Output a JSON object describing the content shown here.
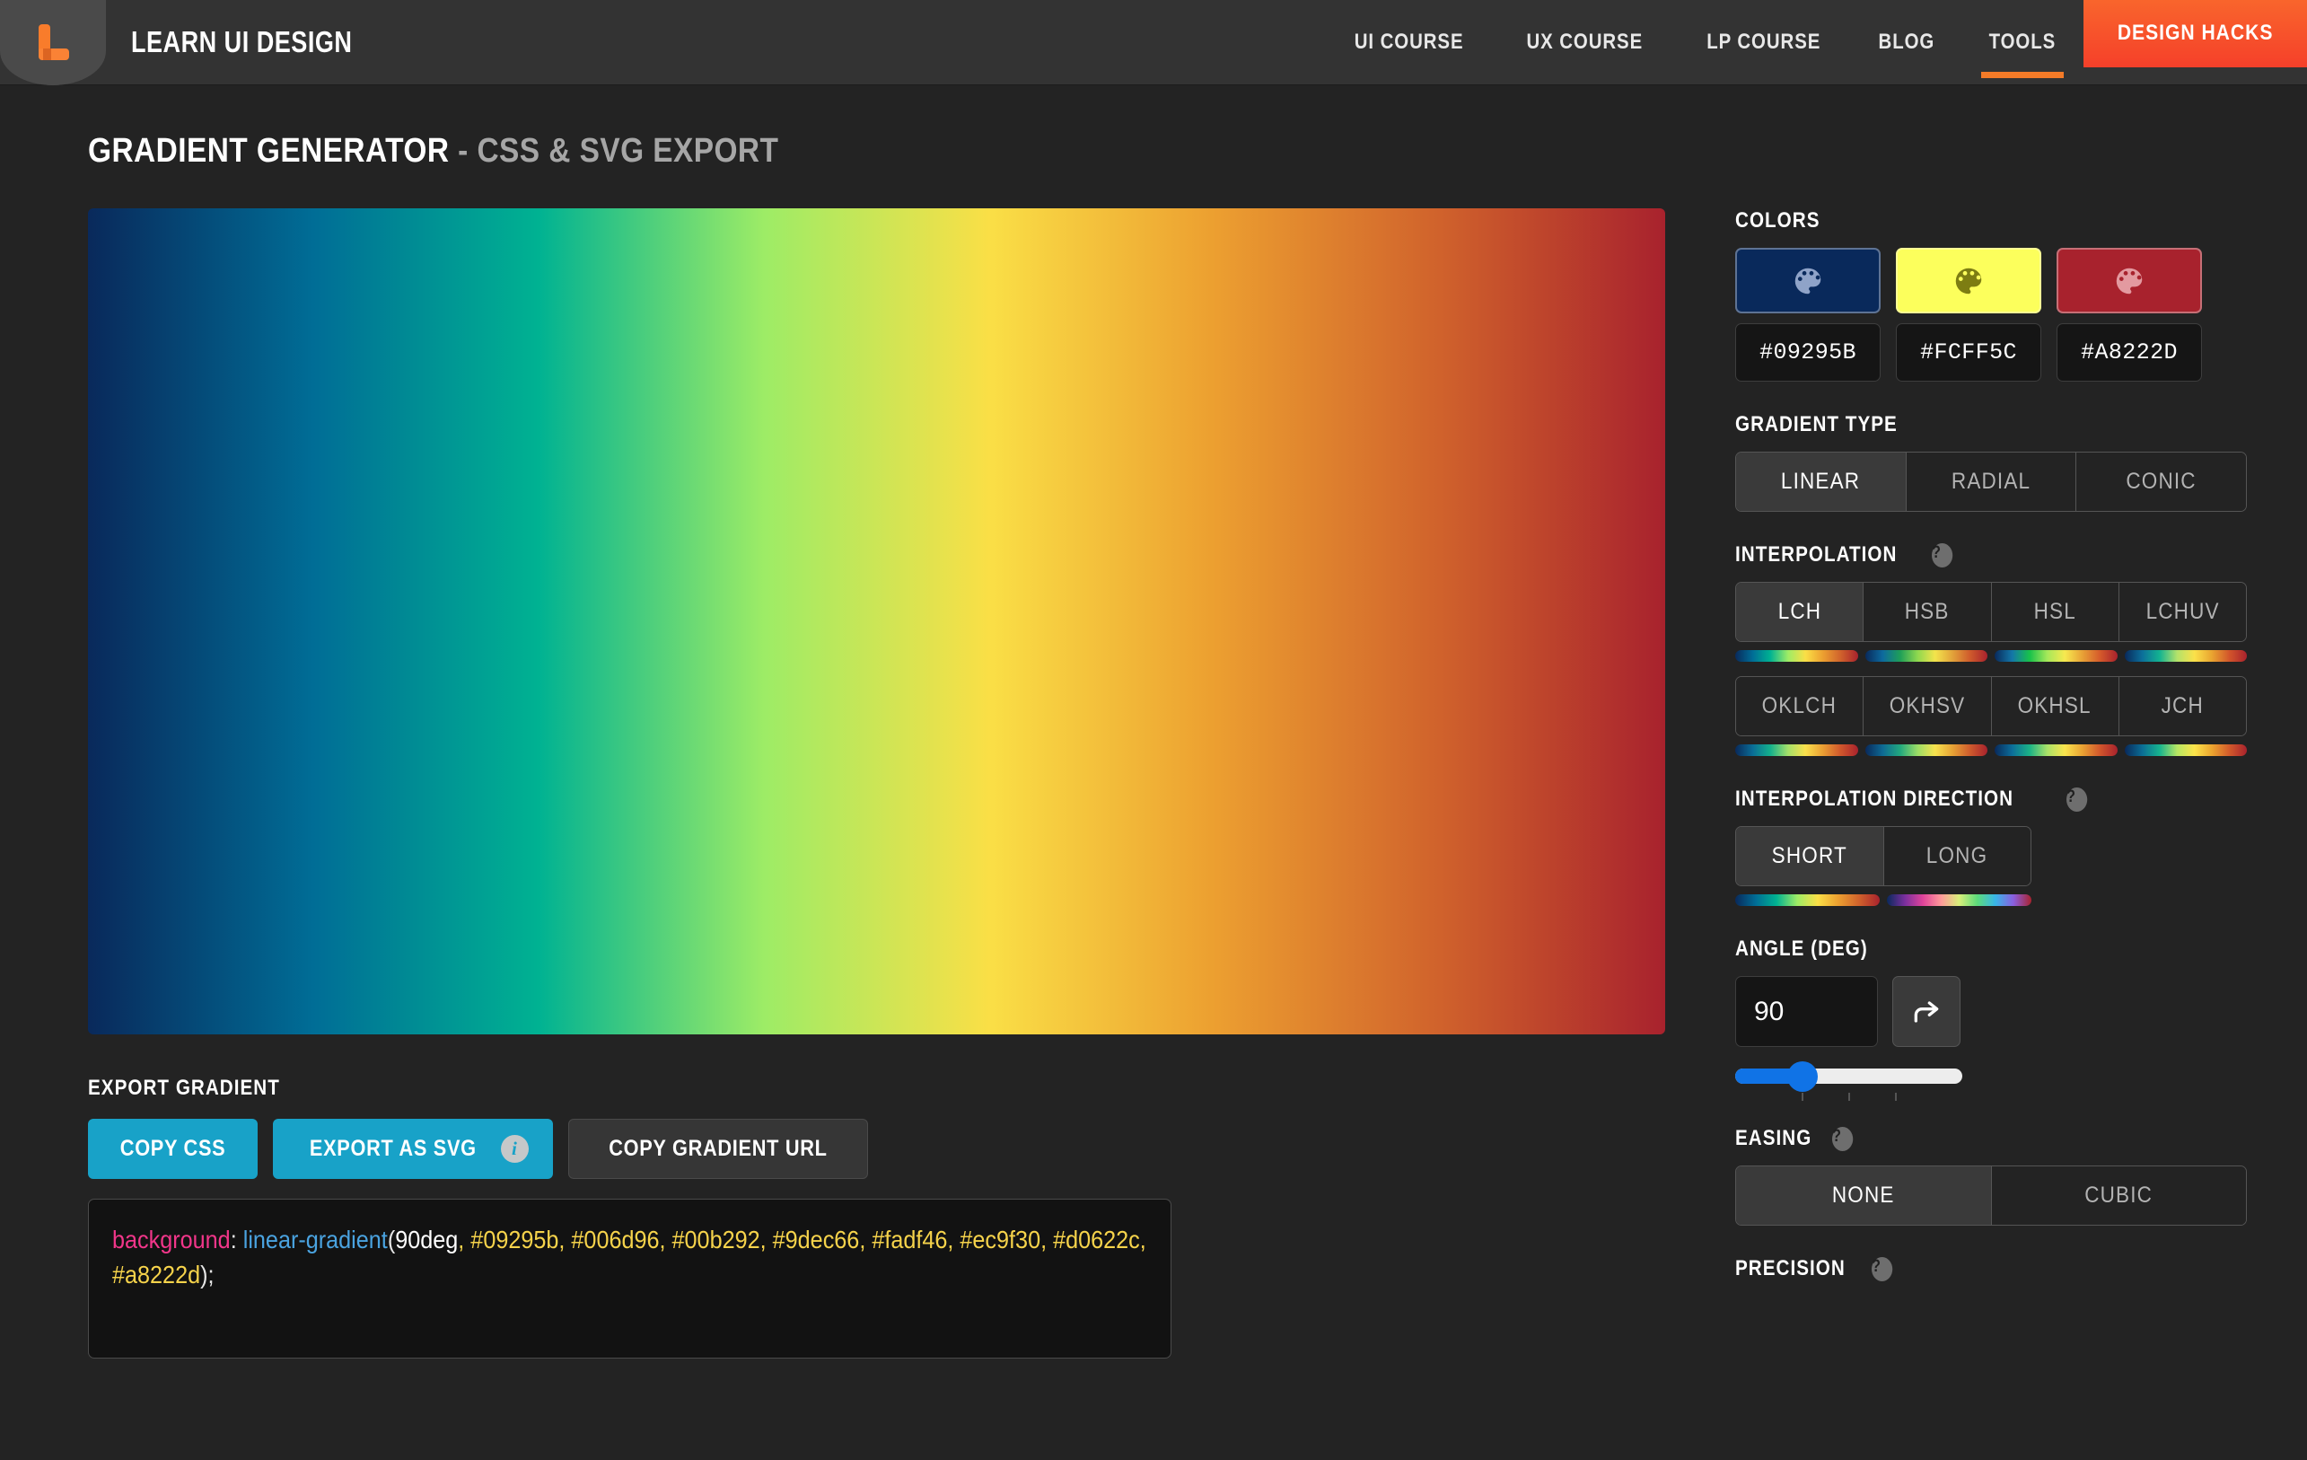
{
  "header": {
    "logo_icon": "learn-ui-design-logo-icon",
    "brand": "LEARN UI DESIGN",
    "nav": [
      {
        "label": "UI COURSE",
        "active": false
      },
      {
        "label": "UX COURSE",
        "active": false
      },
      {
        "label": "LP COURSE",
        "active": false
      },
      {
        "label": "BLOG",
        "active": false
      },
      {
        "label": "TOOLS",
        "active": true
      }
    ],
    "cta": {
      "label": "DESIGN HACKS",
      "color": "#f5502a"
    }
  },
  "page": {
    "title_main": "GRADIENT GENERATOR",
    "title_sep": " - ",
    "title_sub": "CSS & SVG EXPORT"
  },
  "preview": {
    "css_gradient": "linear-gradient(90deg, #09295b, #006d96, #00b292, #9dec66, #fadf46, #ec9f30, #d0622c, #a8222d)"
  },
  "export": {
    "label": "EXPORT GRADIENT",
    "buttons": [
      {
        "label": "COPY CSS",
        "style": "primary",
        "icon": null
      },
      {
        "label": "EXPORT AS SVG",
        "style": "primary",
        "icon": "info-icon"
      },
      {
        "label": "COPY GRADIENT URL",
        "style": "ghost",
        "icon": null
      }
    ],
    "code": {
      "property": "background",
      "colon": ": ",
      "function": "linear-gradient",
      "open_paren": "(",
      "angle": "90deg",
      "comma": ", ",
      "stops": "#09295b, #006d96, #00b292, #9dec66, #fadf46, #ec9f30, #d0622c, #a8222d",
      "close": ");"
    }
  },
  "sidebar": {
    "colors": {
      "label": "COLORS",
      "swatches": [
        {
          "hex": "#09295B",
          "fill": "#09295b",
          "icon": "palette-icon"
        },
        {
          "hex": "#FCFF5C",
          "fill": "#fcff5c",
          "icon": "palette-icon"
        },
        {
          "hex": "#A8222D",
          "fill": "#a8222d",
          "icon": "palette-icon"
        }
      ]
    },
    "gradient_type": {
      "label": "GRADIENT TYPE",
      "options": [
        "LINEAR",
        "RADIAL",
        "CONIC"
      ],
      "selected": "LINEAR"
    },
    "interpolation": {
      "label": "INTERPOLATION",
      "help_icon": "help-icon",
      "row1": [
        "LCH",
        "HSB",
        "HSL",
        "LCHUV"
      ],
      "row2": [
        "OKLCH",
        "OKHSV",
        "OKHSL",
        "JCH"
      ],
      "selected": "LCH",
      "strips_row1": [
        "linear-gradient(90deg,#09295b,#006d96,#00b292,#9dec66,#fadf46,#ec9f30,#d0622c,#a8222d)",
        "linear-gradient(90deg,#09295b,#0d6a9e,#1f9f58,#8fd84f,#f3e44c,#e2a23a,#cf5b2c,#a8222d)",
        "linear-gradient(90deg,#09295b,#1477a8,#18c24a,#a6e85a,#f7e94f,#e8a136,#d55a2b,#a8222d)",
        "linear-gradient(90deg,#09295b,#0c6f9a,#13b391,#b3e26a,#fbe14a,#e9a430,#d2552b,#a8222d)"
      ],
      "strips_row2": [
        "linear-gradient(90deg,#09295b,#0a6d96,#14b08c,#a3e06a,#f9e04c,#ea9e33,#d0572c,#a8222d)",
        "linear-gradient(90deg,#09295b,#0e6a94,#22a87e,#9bdd66,#f6e24e,#e6a235,#cf5c2d,#a8222d)",
        "linear-gradient(90deg,#09295b,#0c6e9a,#1bb386,#aae268,#f9e44d,#e9a233,#d1562c,#a8222d)",
        "linear-gradient(90deg,#09295b,#0b6d95,#17b48f,#b6e663,#fbe44a,#eba42f,#d25a2b,#a8222d)"
      ]
    },
    "interpolation_direction": {
      "label": "INTERPOLATION DIRECTION",
      "help_icon": "help-icon",
      "options": [
        "SHORT",
        "LONG"
      ],
      "selected": "SHORT",
      "strips": [
        "linear-gradient(90deg,#09295b,#006d96,#00b292,#9dec66,#fadf46,#ec9f30,#d0622c,#a8222d)",
        "linear-gradient(90deg,#09295b,#7a2f9e,#e0449a,#ff9a9a,#d8ef7a,#5ddb7a,#38b6e8,#8a5fe0,#a8222d)"
      ]
    },
    "angle": {
      "label": "ANGLE (DEG)",
      "value": "90",
      "flip_icon": "rotate-arrow-icon",
      "slider_percent": 25,
      "slider_min": 0,
      "slider_max": 360
    },
    "easing": {
      "label": "EASING",
      "help_icon": "help-icon",
      "options": [
        "NONE",
        "CUBIC"
      ],
      "selected": "NONE"
    },
    "precision": {
      "label": "PRECISION",
      "help_icon": "help-icon"
    }
  }
}
